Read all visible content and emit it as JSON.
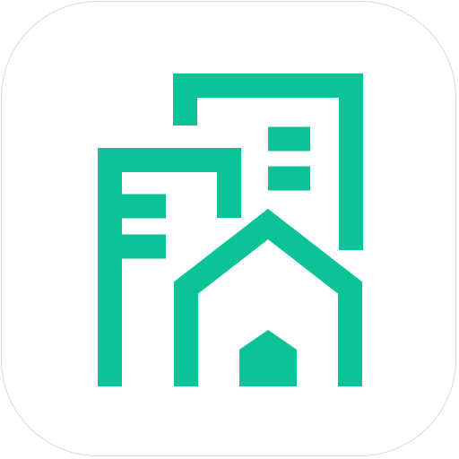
{
  "app_icon": {
    "label": "",
    "glyph": "buildings-with-house-icon",
    "colors": {
      "background": "#ffffff",
      "border": "#d9d9d9",
      "accent": "#0bc397"
    }
  }
}
